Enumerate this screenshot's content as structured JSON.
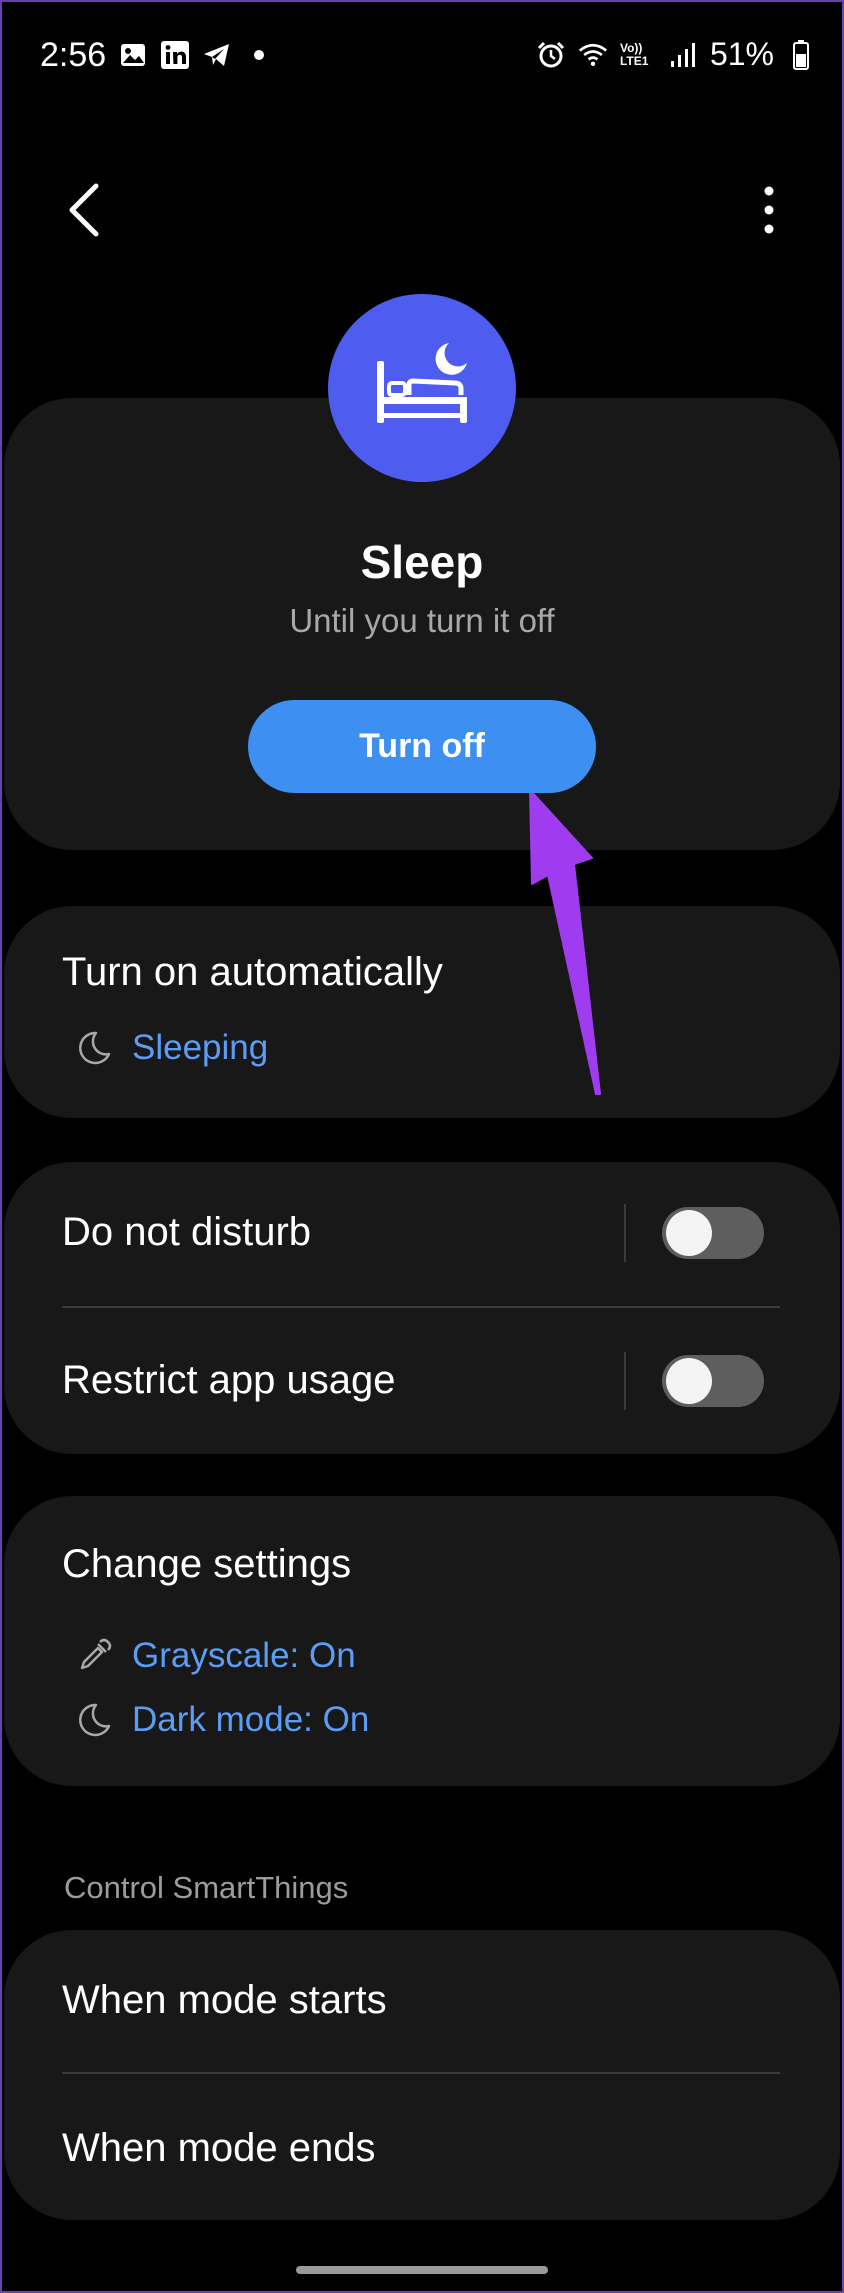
{
  "status_bar": {
    "time": "2:56",
    "left_icons": [
      "image-icon",
      "linkedin-icon",
      "telegram-icon",
      "dot-icon"
    ],
    "right_icons": [
      "alarm-icon",
      "wifi-icon",
      "volte-icon",
      "signal-icon"
    ],
    "volte_text": "Vo)) LTE1",
    "battery": "51%"
  },
  "header": {
    "back_icon": "chevron-left-icon",
    "menu_icon": "more-vert-icon"
  },
  "mode": {
    "icon": "bed-moon-icon",
    "icon_color": "#4e5cf0",
    "title": "Sleep",
    "subtitle": "Until you turn it off",
    "button_label": "Turn off",
    "button_color": "#3d8ff2"
  },
  "auto": {
    "title": "Turn on automatically",
    "item": {
      "icon": "moon-icon",
      "label": "Sleeping"
    }
  },
  "toggles": [
    {
      "label": "Do not disturb",
      "on": false
    },
    {
      "label": "Restrict app usage",
      "on": false
    }
  ],
  "settings": {
    "title": "Change settings",
    "items": [
      {
        "icon": "eyedropper-icon",
        "label": "Grayscale: On"
      },
      {
        "icon": "moon-icon",
        "label": "Dark mode: On"
      }
    ]
  },
  "smartthings": {
    "section_label": "Control SmartThings",
    "items": [
      {
        "label": "When mode starts"
      },
      {
        "label": "When mode ends"
      }
    ]
  },
  "colors": {
    "accent_link": "#5d9cf5",
    "annotation_arrow": "#a03cf0",
    "card_bg": "#181818"
  }
}
